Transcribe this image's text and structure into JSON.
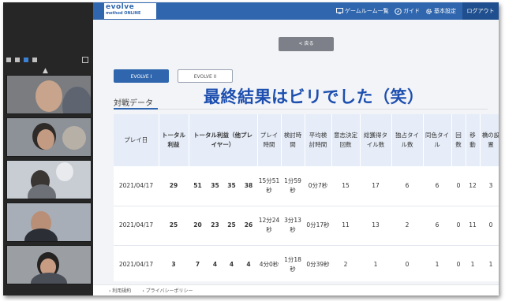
{
  "header": {
    "logo_main": "evolve",
    "logo_sub": "method ONLINE",
    "nav": [
      {
        "label": "ゲームルーム一覧",
        "icon": "monitor-icon"
      },
      {
        "label": "ガイド",
        "icon": "compass-icon"
      },
      {
        "label": "基本設定",
        "icon": "gear-icon"
      }
    ],
    "logout": "ログアウト"
  },
  "back_label": "< 戻る",
  "tabs": [
    "EVOLVE I",
    "EVOLVE II"
  ],
  "section_title": "対戦データ",
  "overlay_text": "最終結果はビリでした（笑）",
  "table": {
    "headers": [
      "プレイ日",
      "トータル利益",
      "トータル利益（他プレイヤー）",
      "プレイ時間",
      "検討時間",
      "平均検討時間",
      "意志決定回数",
      "総獲得タイル数",
      "独占タイル数",
      "同色タイル",
      "回数",
      "移動",
      "橋の設置"
    ],
    "rows": [
      {
        "date": "2021/04/17",
        "total": "29",
        "others": [
          "51",
          "35",
          "35",
          "38"
        ],
        "play_time": "15分51秒",
        "review_time": "1分59秒",
        "avg_review": "0分7秒",
        "decisions": "15",
        "tiles": "17",
        "exclusive": "6",
        "same_color": "6",
        "count": "0",
        "move": "12",
        "bridge": "3"
      },
      {
        "date": "2021/04/17",
        "total": "25",
        "others": [
          "20",
          "23",
          "25",
          "26"
        ],
        "play_time": "12分24秒",
        "review_time": "3分13秒",
        "avg_review": "0分17秒",
        "decisions": "11",
        "tiles": "13",
        "exclusive": "2",
        "same_color": "6",
        "count": "0",
        "move": "11",
        "bridge": "0"
      },
      {
        "date": "2021/04/17",
        "total": "3",
        "others": [
          "7",
          "4",
          "4",
          "4"
        ],
        "play_time": "4分0秒",
        "review_time": "1分18秒",
        "avg_review": "0分39秒",
        "decisions": "2",
        "tiles": "1",
        "exclusive": "0",
        "same_color": "1",
        "count": "0",
        "move": "1",
        "bridge": "1"
      }
    ]
  },
  "footer": [
    "› 利用規約",
    "› プライバシーポリシー"
  ],
  "colors": {
    "brand": "#2f66ad",
    "overlay": "#1d4fb0",
    "table_header": "#e6edf8"
  }
}
